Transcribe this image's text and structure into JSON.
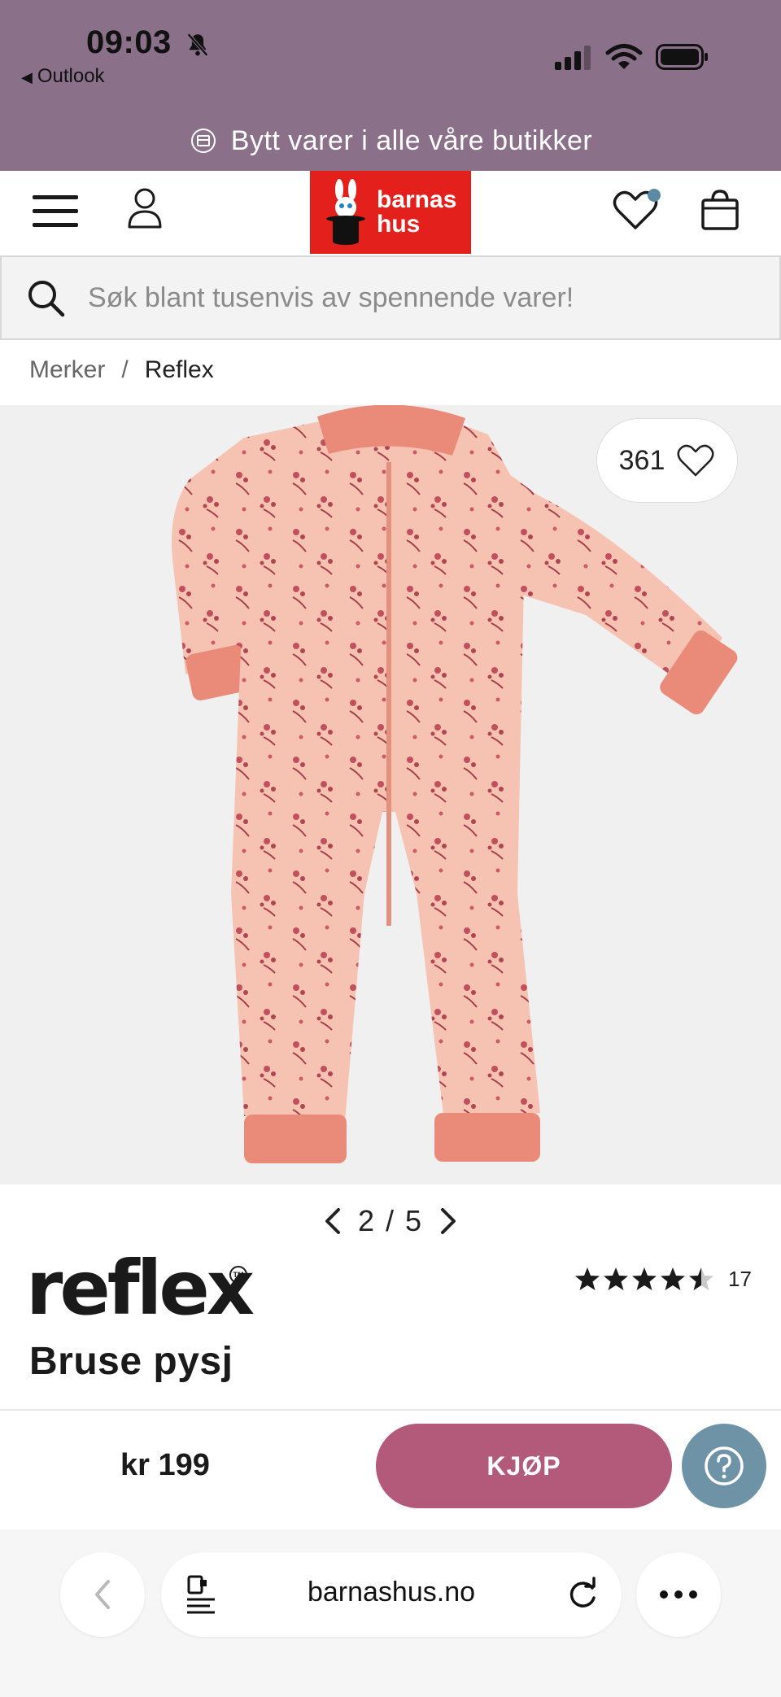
{
  "status_bar": {
    "time": "09:03",
    "back_app": "Outlook",
    "icons": [
      "bell-off-icon",
      "signal-icon",
      "wifi-icon",
      "battery-icon"
    ]
  },
  "promo": {
    "text": "Bytt varer i alle våre butikker",
    "icon": "exchange-icon"
  },
  "header": {
    "logo_line1": "barnas",
    "logo_line2": "hus",
    "icons": [
      "menu-icon",
      "user-icon",
      "heart-icon",
      "bag-icon"
    ],
    "colors": {
      "logo_bg": "#e3201b",
      "band": "#8a7089",
      "wishlist_dot": "#5d8aa3"
    }
  },
  "search": {
    "placeholder": "Søk blant tusenvis av spennende varer!"
  },
  "breadcrumb": {
    "items": [
      "Merker",
      "Reflex"
    ],
    "separator": "/"
  },
  "gallery": {
    "likes": "361",
    "current": "2",
    "total": "5",
    "separator": "/"
  },
  "product": {
    "brand": "reflex",
    "brand_mark": "TM",
    "title": "Bruse pysj",
    "rating": 4.5,
    "rating_count": "17",
    "price": "kr 199"
  },
  "actions": {
    "buy_label": "KJØP",
    "buy_color": "#b35a7a",
    "help_color": "#6e93a6"
  },
  "browser": {
    "url": "barnashus.no"
  }
}
